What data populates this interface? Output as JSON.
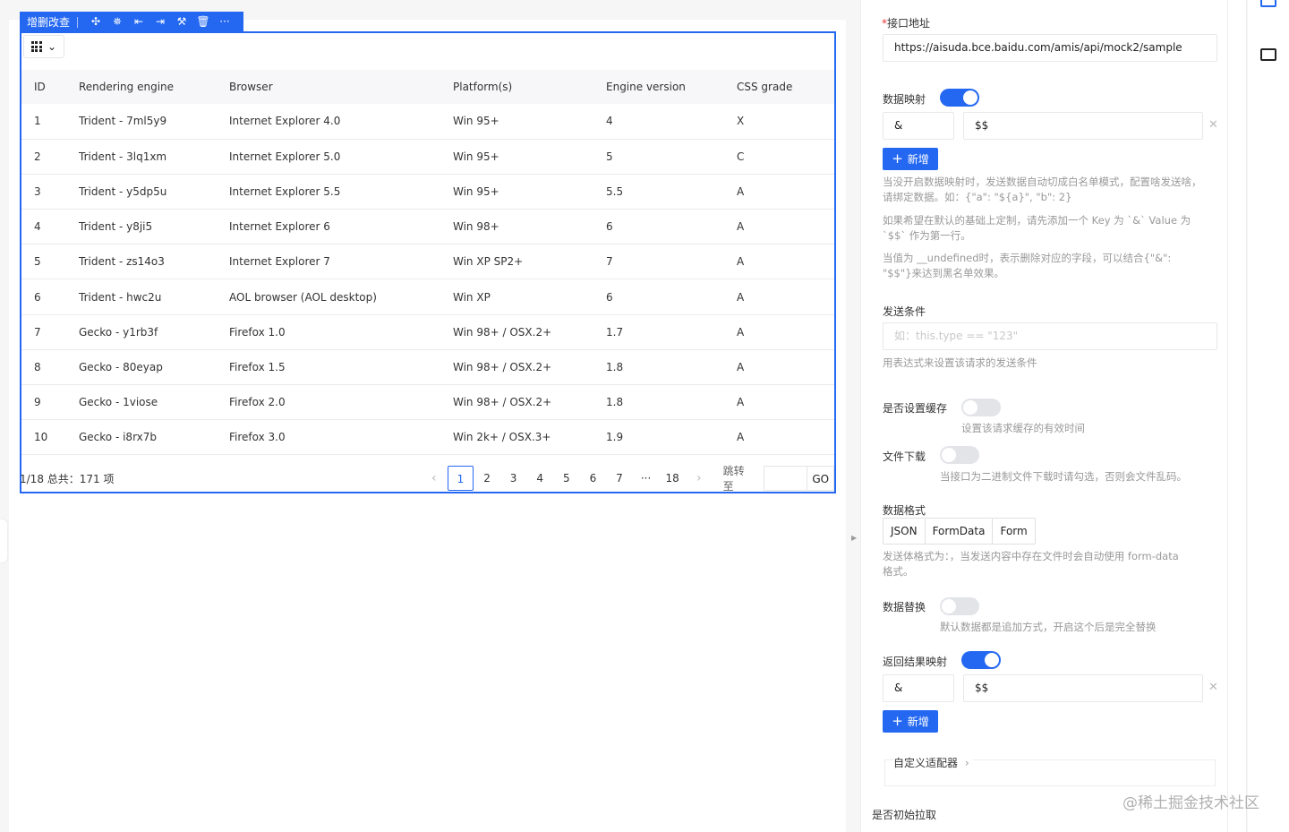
{
  "toolbar": {
    "title": "增删改查",
    "icons": [
      "move-icon",
      "bug-icon",
      "align-left-icon",
      "align-right-icon",
      "hammer-icon",
      "trash-icon",
      "more-icon"
    ],
    "more_label": "···"
  },
  "crud": {
    "columns_toggle": "column-grid-icon",
    "headers": [
      "ID",
      "Rendering engine",
      "Browser",
      "Platform(s)",
      "Engine version",
      "CSS grade"
    ],
    "rows": [
      [
        "1",
        "Trident - 7ml5y9",
        "Internet Explorer 4.0",
        "Win 95+",
        "4",
        "X"
      ],
      [
        "2",
        "Trident - 3lq1xm",
        "Internet Explorer 5.0",
        "Win 95+",
        "5",
        "C"
      ],
      [
        "3",
        "Trident - y5dp5u",
        "Internet Explorer 5.5",
        "Win 95+",
        "5.5",
        "A"
      ],
      [
        "4",
        "Trident - y8ji5",
        "Internet Explorer 6",
        "Win 98+",
        "6",
        "A"
      ],
      [
        "5",
        "Trident - zs14o3",
        "Internet Explorer 7",
        "Win XP SP2+",
        "7",
        "A"
      ],
      [
        "6",
        "Trident - hwc2u",
        "AOL browser (AOL desktop)",
        "Win XP",
        "6",
        "A"
      ],
      [
        "7",
        "Gecko - y1rb3f",
        "Firefox 1.0",
        "Win 98+ / OSX.2+",
        "1.7",
        "A"
      ],
      [
        "8",
        "Gecko - 80eyap",
        "Firefox 1.5",
        "Win 98+ / OSX.2+",
        "1.8",
        "A"
      ],
      [
        "9",
        "Gecko - 1viose",
        "Firefox 2.0",
        "Win 98+ / OSX.2+",
        "1.8",
        "A"
      ],
      [
        "10",
        "Gecko - i8rx7b",
        "Firefox 3.0",
        "Win 2k+ / OSX.3+",
        "1.9",
        "A"
      ]
    ],
    "pager": {
      "info": "1/18 总共：171 项",
      "prev": "‹",
      "pages": [
        "1",
        "2",
        "3",
        "4",
        "5",
        "6",
        "7",
        "···",
        "18"
      ],
      "active_page": "1",
      "next": "›",
      "jump_label": "跳转至",
      "go_label": "GO"
    }
  },
  "panel": {
    "api_label": "接口地址",
    "api_required_mark": "*",
    "api_value": "https://aisuda.bce.baidu.com/amis/api/mock2/sample",
    "data_mapping_label": "数据映射",
    "data_mapping_on": true,
    "data_mapping_key": "&",
    "data_mapping_value": "$$",
    "add_label": "新增",
    "hint1_line1": "当没开启数据映射时，发送数据自动切成白名单模式，配置啥发送啥，",
    "hint1_line2": "请绑定数据。如：{\"a\": \"${a}\", \"b\": 2}",
    "hint2_line1": "如果希望在默认的基础上定制，请先添加一个 Key 为 `&` Value 为",
    "hint2_line2": "`$$` 作为第一行。",
    "hint3_line1": "当值为 __undefined时，表示删除对应的字段，可以结合{\"&\":",
    "hint3_line2": "\"$$\"}来达到黑名单效果。",
    "send_condition_label": "发送条件",
    "send_condition_placeholder": "如：this.type == \"123\"",
    "send_condition_hint": "用表达式来设置该请求的发送条件",
    "cache_label": "是否设置缓存",
    "cache_on": false,
    "cache_hint": "设置该请求缓存的有效时间",
    "download_label": "文件下载",
    "download_on": false,
    "download_hint": "当接口为二进制文件下载时请勾选，否则会文件乱码。",
    "data_format_label": "数据格式",
    "data_format_options": [
      "JSON",
      "FormData",
      "Form"
    ],
    "data_format_hint_line1": "发送体格式为：，当发送内容中存在文件时会自动使用 form-data",
    "data_format_hint_line2": "格式。",
    "replace_label": "数据替换",
    "replace_on": false,
    "replace_hint": "默认数据都是追加方式，开启这个后是完全替换",
    "response_mapping_label": "返回结果映射",
    "response_mapping_on": true,
    "response_mapping_key": "&",
    "response_mapping_value": "$$",
    "adaptor_label": "自定义适配器",
    "initial_fetch_label": "是否初始拉取"
  },
  "watermark": "@稀土掘金技术社区",
  "colors": {
    "accent": "#2468f2",
    "border": "#e8e8e8",
    "hint": "#999999"
  }
}
